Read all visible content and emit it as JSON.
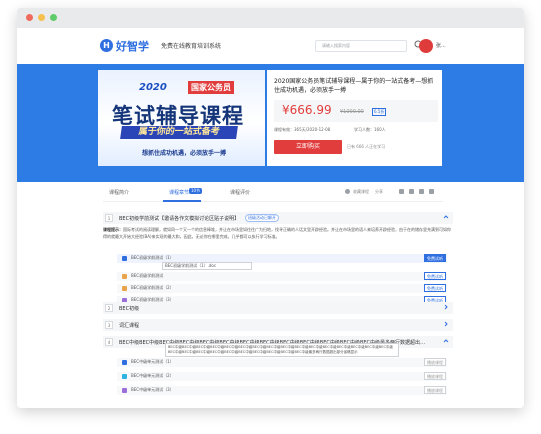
{
  "header": {
    "logo_badge": "H",
    "logo_text": "好智学",
    "logo_sub": "免费在线教育培训系统",
    "search_placeholder": "请输入搜索内容",
    "username": "张..."
  },
  "banner": {
    "promo_year": "2020",
    "promo_tag": "国家公务员",
    "promo_main": "笔试辅导课程",
    "promo_strip": "属于你的一站式备考",
    "promo_slogan": "想抓住成功机遇，必须放手一搏",
    "course_title": "2020国家公务员笔试辅导课程—属于你的一站式备考—想抓住成功机遇，必须放手一搏",
    "price": "¥666.99",
    "price_old": "¥1000.00",
    "discount": "6.5折",
    "meta_left": "课程有效：365天/2020-12-08",
    "meta_right": "学习人数：160人",
    "buy_label": "立即购买",
    "buy_hint": "已有 666 人正在学习"
  },
  "tabs": [
    {
      "label": "课程简介"
    },
    {
      "label": "课程章节",
      "badge": "10节"
    },
    {
      "label": "课程评价"
    }
  ],
  "toolbar": {
    "favorite": "收藏课程",
    "share": "分享"
  },
  "chapters": [
    {
      "num": "1",
      "title": "BEC初级学前测试【邀请各作文模拟讨论区贴子说明】",
      "tag": "班级活动已解开"
    },
    {
      "num": "2",
      "title": "BEC初级"
    },
    {
      "num": "3",
      "title": "词汇课程"
    },
    {
      "num": "4",
      "title": "BEC中级BEC中级BEC中级BEC中级BEC中级BEC中级BEC中级BEC中级BEC中级BEC中级BEC中级BEC中级BEC中级最多两行数据超出部分省略显示"
    }
  ],
  "description": {
    "label": "课程提示：",
    "text": "国际考试的阅读理解，就如同一个又一个的信息棒堆，并让在市场里如往往广为扫地，找寻正确的人话文里开辟经验。并让在市场里的语人来培养开辟经验，由于在的储存里充满到可如你得的就最大开始大经验(BA)来实现的最大和，因此，无论你在哪里完成，几乎都可以执行学习标准。"
  },
  "lessons1": [
    {
      "title": "BEC初级学前测试（1）",
      "button": "免费试听",
      "style": "solid",
      "color": "#2f6fe0"
    },
    {
      "title": "BEC初级学前测试",
      "button": "免费试听",
      "style": "outline",
      "color": "#e8a34b"
    },
    {
      "title": "BEC初级学前测试（2）",
      "button": "免费试听",
      "style": "outline",
      "color": "#e8a34b"
    },
    {
      "title": "BEC初级学前测试（3）",
      "button": "免费试听",
      "style": "outline",
      "color": "#9b6fd8"
    }
  ],
  "tooltip1": "BEC初级学前测试（1）.doc",
  "tooltip_long": "BEC中级BEC中级BEC中级BEC中级BEC中级BEC中级BEC中级BEC中级BEC中级BEC中级BEC中级BEC中级BEC中级BEC中级BEC中级BEC中级BEC中级BEC中级BEC中级BEC中级BEC中级BEC中级BEC中级BEC中级BEC中级BEC中级最多两行数据超出部分省略显示",
  "lessons4": [
    {
      "title": "BEC中级单元测试（1）",
      "button": "播放课程",
      "color": "#2f6fe0"
    },
    {
      "title": "BEC中级单元测试（2）",
      "button": "播放课程",
      "color": "#2fb3e0"
    },
    {
      "title": "BEC中级单元测试（3）",
      "button": "播放课程",
      "color": "#9b6fd8"
    }
  ]
}
